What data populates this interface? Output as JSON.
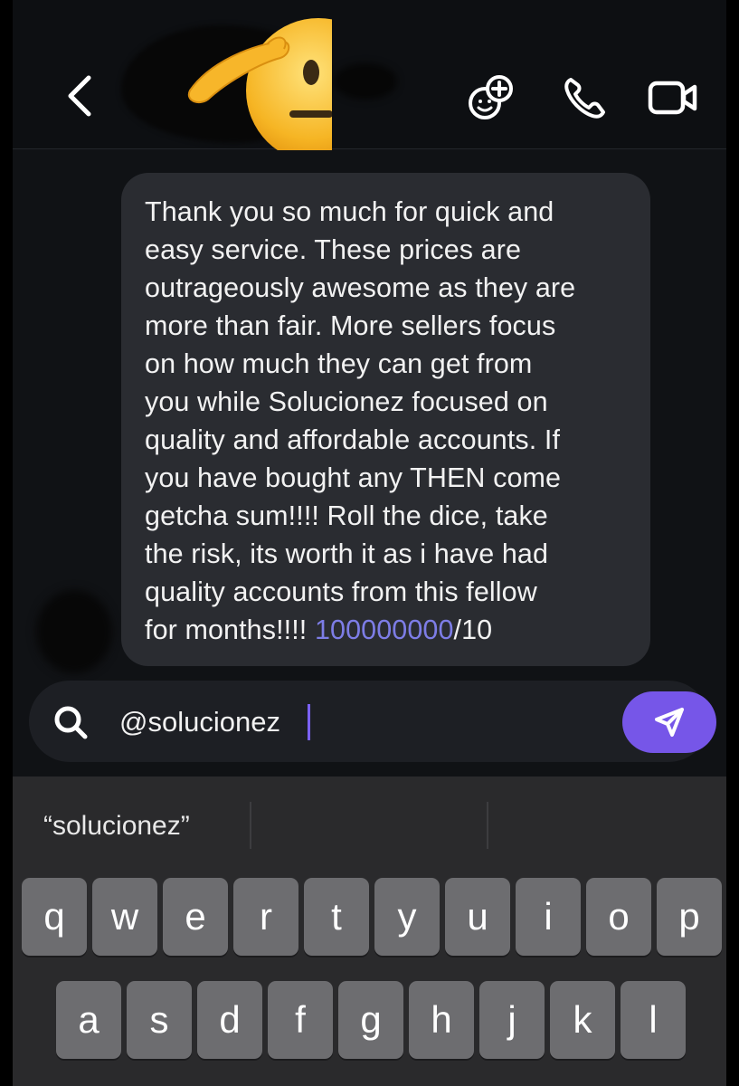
{
  "header": {
    "back_icon": "chevron-left-icon",
    "actions": [
      "video-chat-add-icon",
      "phone-icon",
      "video-camera-icon"
    ]
  },
  "message": {
    "text": "Thank you so much for quick and\neasy service. These prices are\noutrageously awesome as they are\nmore than fair. More sellers focus\non how much they can get from\nyou while Solucionez focused on\nquality and affordable accounts. If\nyou have bought any THEN come\ngetcha sum!!!! Roll the dice, take\nthe risk, its worth it as i have had\nquality accounts from this fellow\nfor months!!!! ",
    "rating_value": "100000000",
    "rating_suffix": "/10"
  },
  "composer": {
    "value": "@solucionez",
    "search_icon": "search-icon",
    "send_icon": "send-icon"
  },
  "keyboard": {
    "suggestion": "“solucionez”",
    "row1": [
      "q",
      "w",
      "e",
      "r",
      "t",
      "y",
      "u",
      "i",
      "o",
      "p"
    ],
    "row2": [
      "a",
      "s",
      "d",
      "f",
      "g",
      "h",
      "j",
      "k",
      "l"
    ]
  },
  "colors": {
    "accent": "#7656e8",
    "link": "#7d7de6",
    "bubble": "#2a2c31",
    "background": "#101215"
  }
}
